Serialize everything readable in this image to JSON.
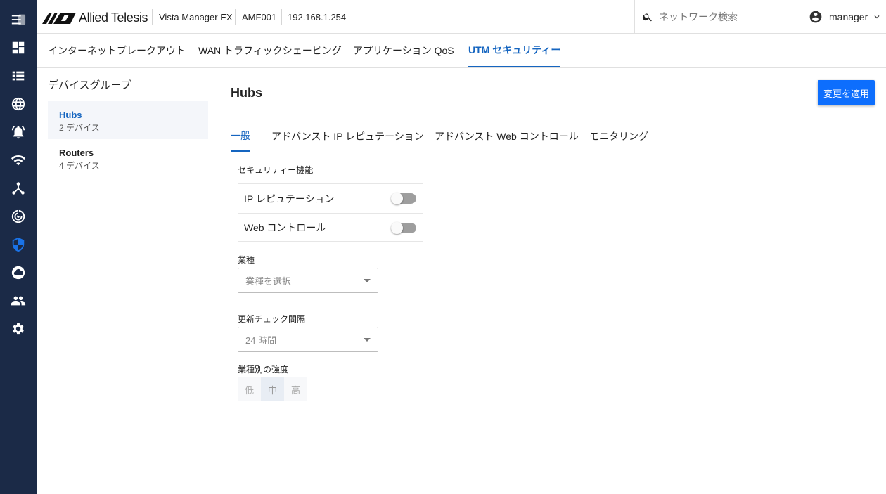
{
  "header": {
    "brand": "Allied Telesis",
    "product": "Vista Manager EX",
    "device": "AMF001",
    "ip": "192.168.1.254",
    "search_placeholder": "ネットワーク検索",
    "user": "manager"
  },
  "sidebar": {
    "items": [
      {
        "icon": "menu-collapse-icon"
      },
      {
        "icon": "dashboard-icon"
      },
      {
        "icon": "list-icon"
      },
      {
        "icon": "globe-icon"
      },
      {
        "icon": "alarm-bell-icon"
      },
      {
        "icon": "wifi-icon"
      },
      {
        "icon": "network-topology-icon"
      },
      {
        "icon": "radar-icon"
      },
      {
        "icon": "shield-icon",
        "active": true
      },
      {
        "icon": "cloud-icon"
      },
      {
        "icon": "people-icon"
      },
      {
        "icon": "settings-gear-icon"
      }
    ]
  },
  "tabs": [
    {
      "label": "インターネットブレークアウト"
    },
    {
      "label": "WAN トラフィックシェーピング"
    },
    {
      "label": "アプリケーション QoS"
    },
    {
      "label": "UTM セキュリティー",
      "active": true
    }
  ],
  "groups": {
    "title": "デバイスグループ",
    "items": [
      {
        "name": "Hubs",
        "count": "2 デバイス",
        "active": true
      },
      {
        "name": "Routers",
        "count": "4 デバイス"
      }
    ]
  },
  "main": {
    "title": "Hubs",
    "apply_label": "変更を適用",
    "subtabs": [
      {
        "label": "一般",
        "active": true
      },
      {
        "label": "アドバンスト IP レピュテーション"
      },
      {
        "label": "アドバンスト Web コントロール"
      },
      {
        "label": "モニタリング"
      }
    ],
    "security_label": "セキュリティー機能",
    "features": [
      {
        "label": "IP レピュテーション",
        "enabled": false
      },
      {
        "label": "Web コントロール",
        "enabled": false
      }
    ],
    "industry_label": "業種",
    "industry_placeholder": "業種を選択",
    "interval_label": "更新チェック間隔",
    "interval_value": "24 時間",
    "strength_label": "業種別の強度",
    "strength_options": [
      "低",
      "中",
      "高"
    ],
    "strength_selected": "中"
  },
  "colors": {
    "rail": "#1b2a47",
    "accent": "#1565c0",
    "apply_button": "#0d6efd"
  }
}
